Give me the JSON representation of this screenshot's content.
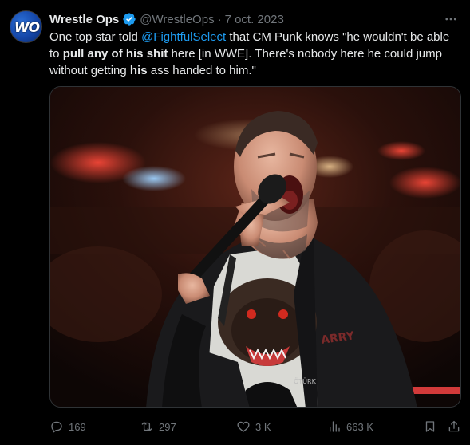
{
  "author": {
    "display_name": "Wrestle Ops",
    "handle": "@WrestleOps",
    "separator": "·",
    "date": "7 oct. 2023",
    "avatar_monogram": "WO",
    "verified_color": "#1d9bf0"
  },
  "tweet": {
    "text_1": "One top star told ",
    "mention": "@FightfulSelect",
    "text_2": " that CM Punk knows \"he wouldn't be able to ",
    "bold_1": "pull any of his shit",
    "text_3": " here [in WWE]. There's nobody here he could jump without getting ",
    "bold_2": "his",
    "text_4": " ass handed to him.\""
  },
  "media": {
    "shirt_text": "ARRY",
    "pouch_label": "ÖTÜRK"
  },
  "actions": {
    "replies": "169",
    "reposts": "297",
    "likes": "3 K",
    "views": "663 K"
  },
  "icons": {
    "more": "more-icon",
    "reply": "reply-icon",
    "repost": "repost-icon",
    "like": "heart-icon",
    "views": "views-icon",
    "bookmark": "bookmark-icon",
    "share": "share-icon"
  },
  "colors": {
    "background": "#000000",
    "text": "#e7e9ea",
    "muted": "#71767b",
    "link": "#1d9bf0"
  }
}
